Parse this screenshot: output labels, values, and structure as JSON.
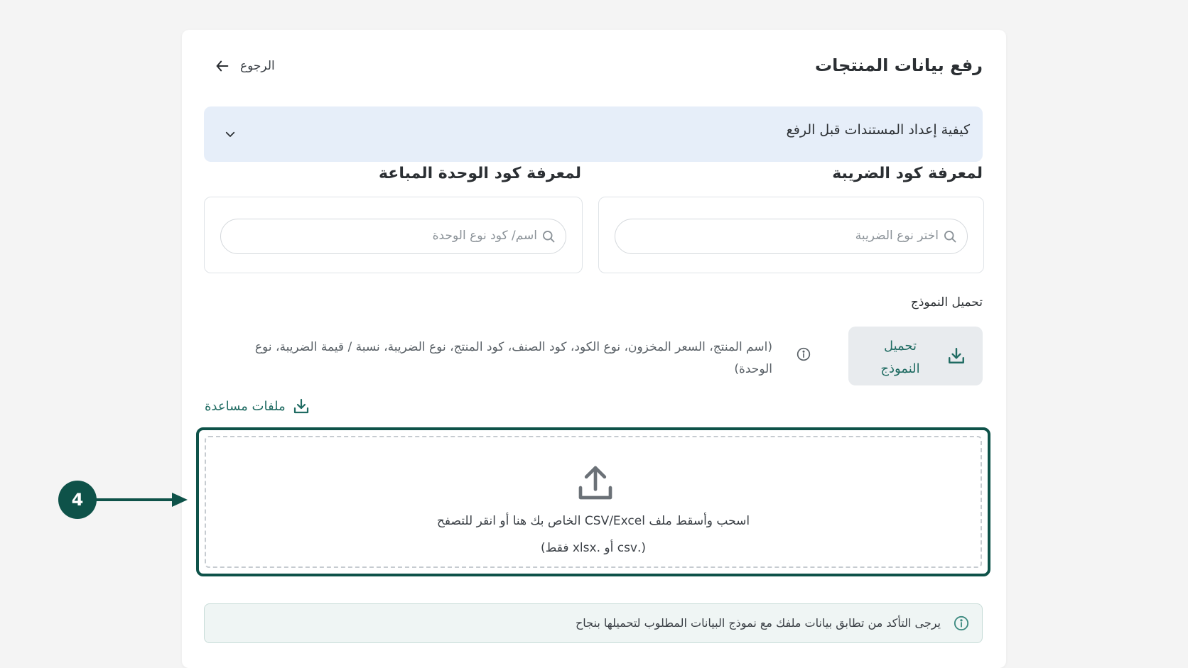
{
  "page": {
    "title": "رفع بيانات المنتجات",
    "back_label": "الرجوع"
  },
  "accordion": {
    "label": "كيفية إعداد المستندات قبل الرفع",
    "icon": "chevron-down-icon"
  },
  "tax_section": {
    "heading": "لمعرفة كود الضريبة",
    "placeholder": "اختر نوع الضريبة"
  },
  "unit_section": {
    "heading": "لمعرفة كود الوحدة المباعة",
    "placeholder": "اسم/ كود نوع الوحدة"
  },
  "template": {
    "label": "تحميل النموذج",
    "button_label": "تحميل النموذج",
    "columns_note": "(اسم المنتج، السعر المخزون، نوع الكود، كود الصنف، كود المنتج، نوع الضريبة، نسبة / قيمة الضريبة، نوع الوحدة)"
  },
  "help_files": {
    "label": "ملفات مساعدة"
  },
  "dropzone": {
    "line1": "اسحب وأسقط ملف CSV/Excel الخاص بك هنا أو انقر للتصفح",
    "line2": "(.csv أو .xlsx فقط)"
  },
  "notice": {
    "text": "يرجى التأكد من تطابق بيانات ملفك مع نموذج البيانات المطلوب لتحميلها بنجاح"
  },
  "annotation": {
    "step_number": "4"
  },
  "colors": {
    "primary": "#0e5249",
    "accent_text": "#1f6b62",
    "accordion_bg": "#e6eef9",
    "notice_bg": "#eff5f4"
  }
}
